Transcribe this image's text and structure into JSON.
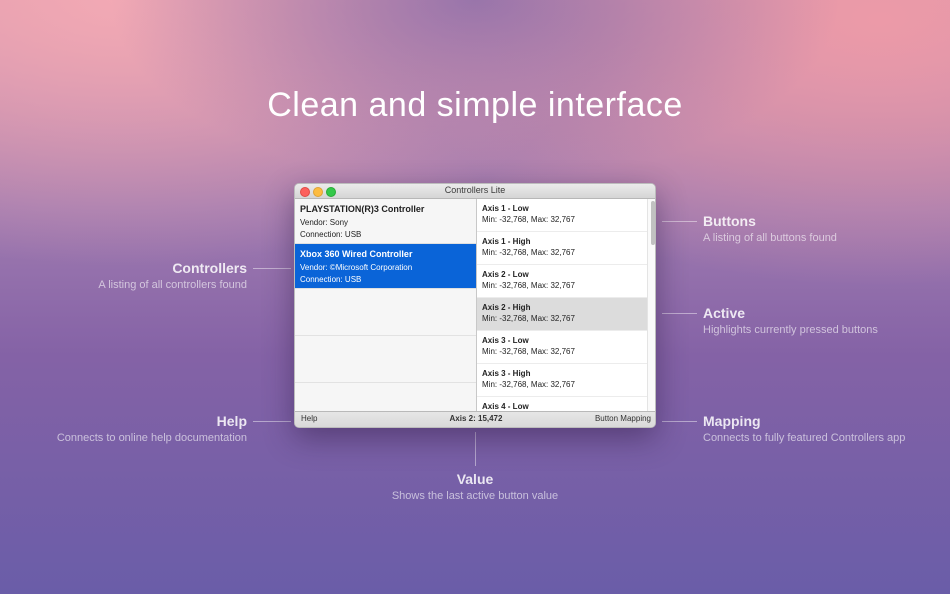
{
  "headline": "Clean and simple interface",
  "window": {
    "title": "Controllers Lite",
    "controllers": [
      {
        "name": "PLAYSTATION(R)3 Controller",
        "vendor": "Vendor: Sony",
        "connection": "Connection: USB",
        "selected": false
      },
      {
        "name": "Xbox 360 Wired Controller",
        "vendor": "Vendor: ©Microsoft Corporation",
        "connection": "Connection: USB",
        "selected": true
      }
    ],
    "axes": [
      {
        "name": "Axis 1 - Low",
        "range": "Min: -32,768, Max: 32,767",
        "active": false
      },
      {
        "name": "Axis 1 - High",
        "range": "Min: -32,768, Max: 32,767",
        "active": false
      },
      {
        "name": "Axis 2 - Low",
        "range": "Min: -32,768, Max: 32,767",
        "active": false
      },
      {
        "name": "Axis 2 - High",
        "range": "Min: -32,768, Max: 32,767",
        "active": true
      },
      {
        "name": "Axis 3 - Low",
        "range": "Min: -32,768, Max: 32,767",
        "active": false
      },
      {
        "name": "Axis 3 - High",
        "range": "Min: -32,768, Max: 32,767",
        "active": false
      },
      {
        "name": "Axis 4 - Low",
        "range": "",
        "active": false
      }
    ],
    "status": {
      "help": "Help",
      "value": "Axis 2: 15,472",
      "mapping": "Button Mapping"
    }
  },
  "callouts": {
    "controllers": {
      "title": "Controllers",
      "subtitle": "A listing of all controllers found"
    },
    "help": {
      "title": "Help",
      "subtitle": "Connects to online help documentation"
    },
    "buttons": {
      "title": "Buttons",
      "subtitle": "A listing of all buttons found"
    },
    "active": {
      "title": "Active",
      "subtitle": "Highlights currently pressed buttons"
    },
    "mapping": {
      "title": "Mapping",
      "subtitle": "Connects to fully featured Controllers app"
    },
    "value": {
      "title": "Value",
      "subtitle": "Shows the last active button value"
    }
  },
  "colors": {
    "selection": "#0a64d8",
    "active_row": "#dcdcdc"
  }
}
